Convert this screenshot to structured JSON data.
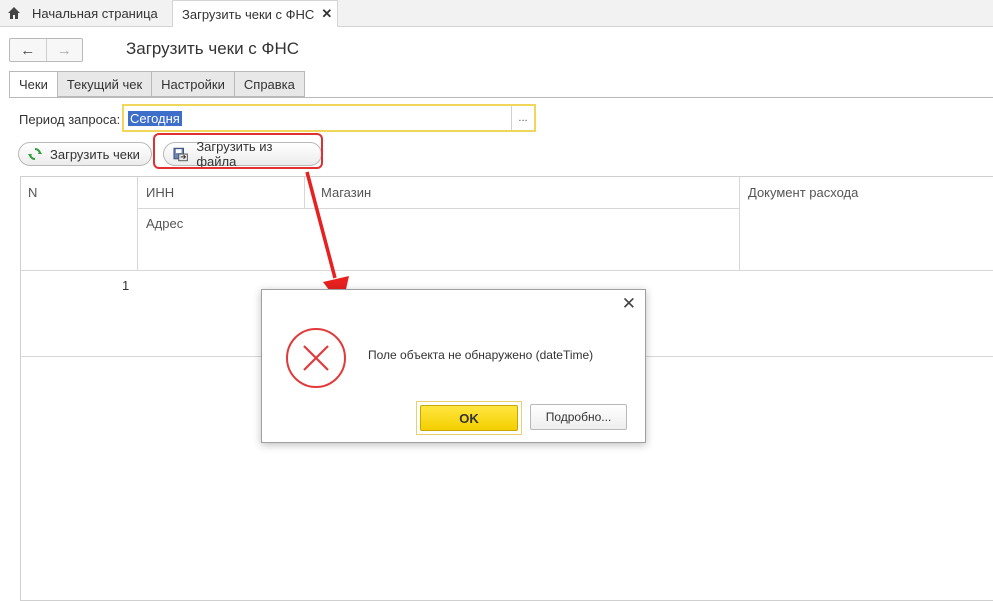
{
  "topbar": {
    "home_label": "Начальная страница",
    "open_tab_label": "Загрузить чеки с ФНС",
    "close_glyph": "✕"
  },
  "nav": {
    "back_glyph": "←",
    "forward_glyph": "→"
  },
  "page": {
    "title": "Загрузить чеки с ФНС"
  },
  "tabs": [
    {
      "label": "Чеки",
      "active": true
    },
    {
      "label": "Текущий чек",
      "active": false
    },
    {
      "label": "Настройки",
      "active": false
    },
    {
      "label": "Справка",
      "active": false
    }
  ],
  "period": {
    "label": "Период запроса:",
    "value": "Сегодня",
    "select_glyph": "..."
  },
  "toolbar": {
    "load_label": "Загрузить чеки",
    "load_file_label": "Загрузить из файла"
  },
  "table": {
    "columns": {
      "n": "N",
      "inn": "ИНН",
      "shop": "Магазин",
      "address": "Адрес",
      "expense_doc": "Документ расхода"
    },
    "rows": [
      {
        "n": "1"
      }
    ]
  },
  "dialog": {
    "message": "Поле объекта не обнаружено (dateTime)",
    "ok_label": "OK",
    "details_label": "Подробно...",
    "close_glyph": "✕"
  },
  "colors": {
    "accent_yellow": "#f5cf00",
    "error_red": "#e03030",
    "selection_blue": "#3d6ec9"
  }
}
